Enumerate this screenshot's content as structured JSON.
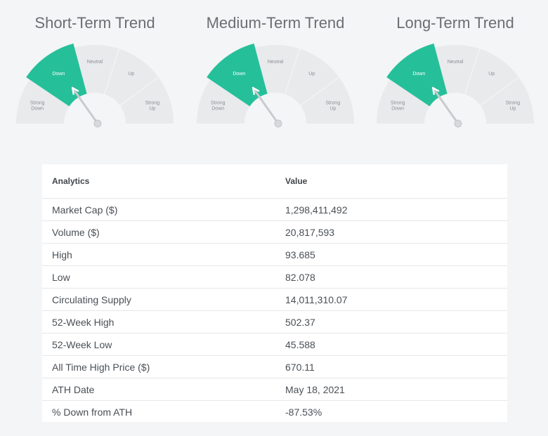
{
  "gauges": [
    {
      "title": "Short-Term Trend",
      "labels": {
        "strong_down": [
          "Strong",
          "Down"
        ],
        "down": "Down",
        "neutral": "Neutral",
        "up": "Up",
        "strong_up": [
          "Strong",
          "Up"
        ]
      },
      "active": "Down"
    },
    {
      "title": "Medium-Term Trend",
      "labels": {
        "strong_down": [
          "Strong",
          "Down"
        ],
        "down": "Down",
        "neutral": "Neutral",
        "up": "Up",
        "strong_up": [
          "Strong",
          "Up"
        ]
      },
      "active": "Down"
    },
    {
      "title": "Long-Term Trend",
      "labels": {
        "strong_down": [
          "Strong",
          "Down"
        ],
        "down": "Down",
        "neutral": "Neutral",
        "up": "Up",
        "strong_up": [
          "Strong",
          "Up"
        ]
      },
      "active": "Down"
    }
  ],
  "colors": {
    "active_segment": "#25c09a",
    "gauge_bg": "#e9eaec",
    "needle": "#c9cbcf"
  },
  "table": {
    "headers": [
      "Analytics",
      "Value"
    ],
    "rows": [
      [
        "Market Cap ($)",
        "1,298,411,492"
      ],
      [
        "Volume ($)",
        "20,817,593"
      ],
      [
        "High",
        "93.685"
      ],
      [
        "Low",
        "82.078"
      ],
      [
        "Circulating Supply",
        "14,011,310.07"
      ],
      [
        "52-Week High",
        "502.37"
      ],
      [
        "52-Week Low",
        "45.588"
      ],
      [
        "All Time High Price ($)",
        "670.11"
      ],
      [
        "ATH Date",
        "May 18, 2021"
      ],
      [
        "% Down from ATH",
        "-87.53%"
      ]
    ]
  }
}
